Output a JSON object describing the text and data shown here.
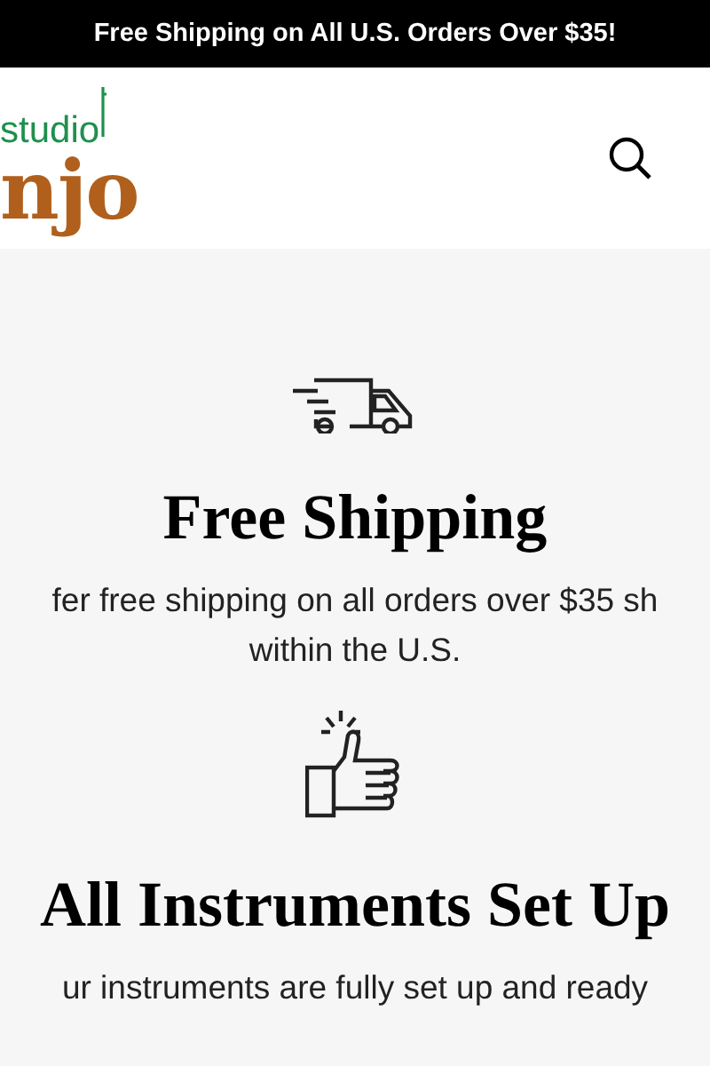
{
  "announcement_bar": {
    "text": "Free Shipping on All U.S. Orders Over $35!"
  },
  "header": {
    "logo": {
      "top": "studio",
      "bottom": "njo"
    }
  },
  "features": [
    {
      "kind": "truck",
      "title": "Free Shipping",
      "lines": [
        "fer free shipping on all orders over $35 sh",
        "within the U.S."
      ]
    },
    {
      "kind": "thumbs-up",
      "title": "All Instruments Set Up",
      "lines": [
        "ur instruments are fully set up and ready"
      ]
    }
  ]
}
